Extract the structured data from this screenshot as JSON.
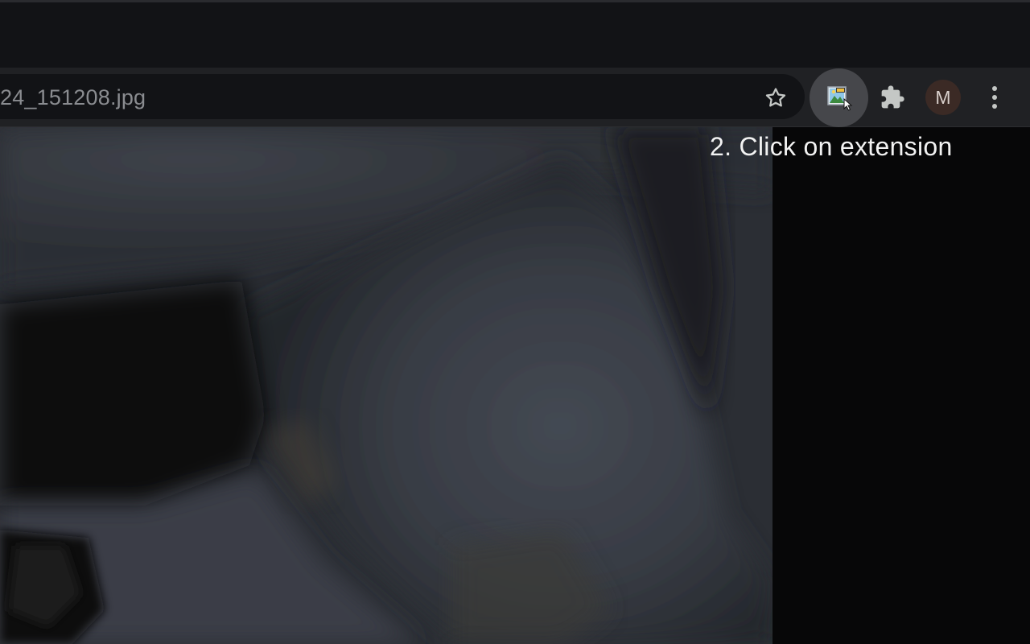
{
  "browser": {
    "omnibox": {
      "url_text": "24_151208.jpg"
    },
    "toolbar": {
      "bookmark_icon": "star-outline-icon",
      "extension_icon": "image-url-extension-icon",
      "extensions_menu_icon": "puzzle-piece-icon",
      "profile_initial": "M",
      "menu_icon": "vertical-dots-icon"
    }
  },
  "annotation": {
    "caption": "2. Click on extension"
  },
  "content": {
    "image_description_icon": "photo-of-fluffy-pet"
  },
  "colors": {
    "tab_strip": "#121316",
    "toolbar": "#202124",
    "omnibox": "#121316",
    "highlight_circle": "#46474b",
    "avatar_bg": "#3b2a25",
    "caption_text": "#f2f2f2"
  }
}
